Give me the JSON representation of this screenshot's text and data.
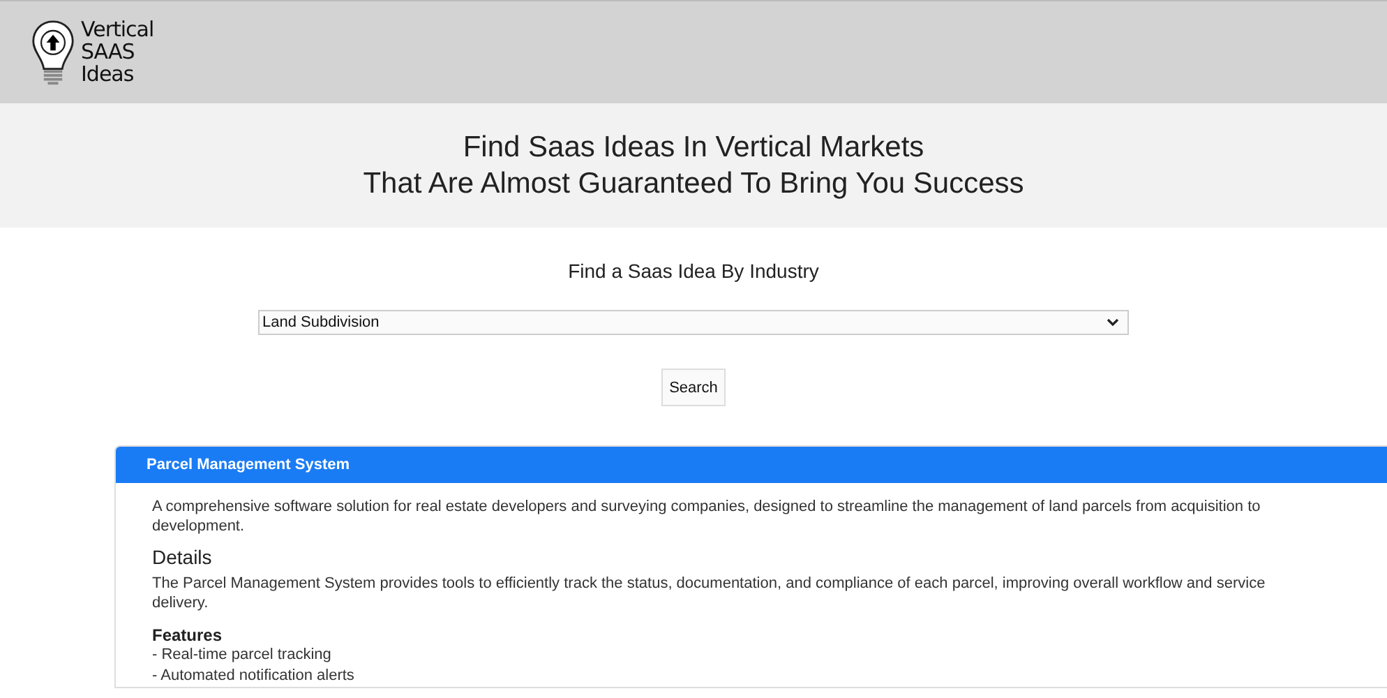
{
  "logo": {
    "lines": [
      "Vertical",
      "SAAS",
      "Ideas"
    ]
  },
  "hero": {
    "lines": [
      "Find Saas Ideas In Vertical Markets",
      "That Are Almost Guaranteed To Bring You Success"
    ]
  },
  "search": {
    "heading": "Find a Saas Idea By Industry",
    "value": "Land Subdivision",
    "button": "Search"
  },
  "card": {
    "title": "Parcel Management System",
    "description": "A comprehensive software solution for real estate developers and surveying companies, designed to streamline the management of land parcels from acquisition to development.",
    "details_heading": "Details",
    "details": "The Parcel Management System provides tools to efficiently track the status, documentation, and compliance of each parcel, improving overall workflow and service delivery.",
    "features_heading": "Features",
    "features": [
      "- Real-time parcel tracking",
      "- Automated notification alerts"
    ]
  }
}
